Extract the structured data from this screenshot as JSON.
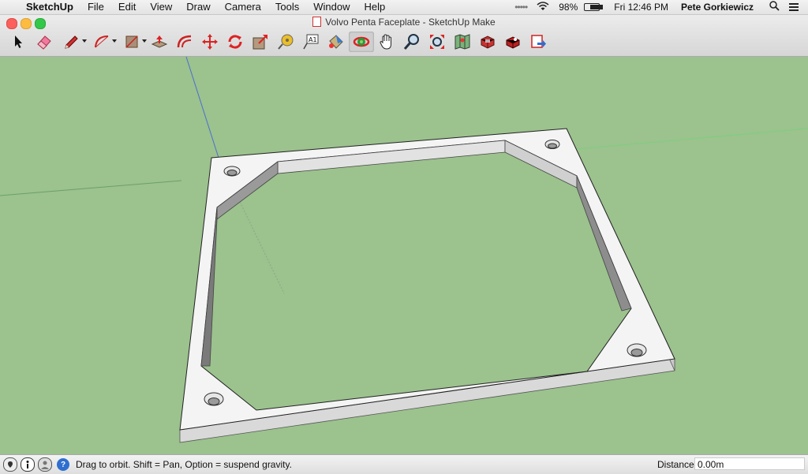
{
  "menubar": {
    "app_name": "SketchUp",
    "items": [
      "File",
      "Edit",
      "View",
      "Draw",
      "Camera",
      "Tools",
      "Window",
      "Help"
    ],
    "wifi_dots": "•••••",
    "battery_percent": "98%",
    "battery_level": 0.98,
    "clock": "Fri 12:46 PM",
    "user": "Pete Gorkiewicz"
  },
  "window": {
    "title": "Volvo Penta Faceplate - SketchUp Make"
  },
  "toolbar": {
    "tools": [
      {
        "name": "select-tool",
        "icon": "arrow-cursor-icon",
        "dropdown": false,
        "active": false
      },
      {
        "name": "eraser-tool",
        "icon": "eraser-icon",
        "dropdown": false,
        "active": false
      },
      {
        "name": "line-tool",
        "icon": "pencil-icon",
        "dropdown": true,
        "active": false
      },
      {
        "name": "arc-tool",
        "icon": "arc-icon",
        "dropdown": true,
        "active": false
      },
      {
        "name": "rectangle-tool",
        "icon": "rectangle-icon",
        "dropdown": true,
        "active": false
      },
      {
        "name": "push-pull-tool",
        "icon": "push-pull-icon",
        "dropdown": false,
        "active": false
      },
      {
        "name": "offset-tool",
        "icon": "offset-icon",
        "dropdown": false,
        "active": false
      },
      {
        "name": "move-tool",
        "icon": "move-icon",
        "dropdown": false,
        "active": false
      },
      {
        "name": "rotate-tool",
        "icon": "rotate-icon",
        "dropdown": false,
        "active": false
      },
      {
        "name": "scale-tool",
        "icon": "scale-icon",
        "dropdown": false,
        "active": false
      },
      {
        "name": "tape-measure-tool",
        "icon": "tape-measure-icon",
        "dropdown": false,
        "active": false
      },
      {
        "name": "text-tool",
        "icon": "text-icon",
        "dropdown": false,
        "active": false
      },
      {
        "name": "paint-bucket-tool",
        "icon": "paint-bucket-icon",
        "dropdown": false,
        "active": false
      },
      {
        "name": "orbit-tool",
        "icon": "orbit-icon",
        "dropdown": false,
        "active": true
      },
      {
        "name": "pan-tool",
        "icon": "hand-icon",
        "dropdown": false,
        "active": false
      },
      {
        "name": "zoom-tool",
        "icon": "magnifier-icon",
        "dropdown": false,
        "active": false
      },
      {
        "name": "zoom-extents-tool",
        "icon": "zoom-extents-icon",
        "dropdown": false,
        "active": false
      },
      {
        "name": "add-location-tool",
        "icon": "map-icon",
        "dropdown": false,
        "active": false
      },
      {
        "name": "3d-warehouse-tool",
        "icon": "warehouse-icon",
        "dropdown": false,
        "active": false
      },
      {
        "name": "extension-warehouse-tool",
        "icon": "extension-icon",
        "dropdown": false,
        "active": false
      },
      {
        "name": "send-to-layout-tool",
        "icon": "layout-icon",
        "dropdown": false,
        "active": false
      }
    ],
    "text_tool_glyph": "A1"
  },
  "statusbar": {
    "message": "Drag to orbit. Shift = Pan, Option = suspend gravity.",
    "help_glyph": "?",
    "distance_label": "Distance",
    "distance_value": "0.00m"
  },
  "colors": {
    "ground": "#9cc28e",
    "model_face": "#f2f2f2",
    "model_side": "#8a8a8a",
    "accent_red": "#d9332b"
  }
}
